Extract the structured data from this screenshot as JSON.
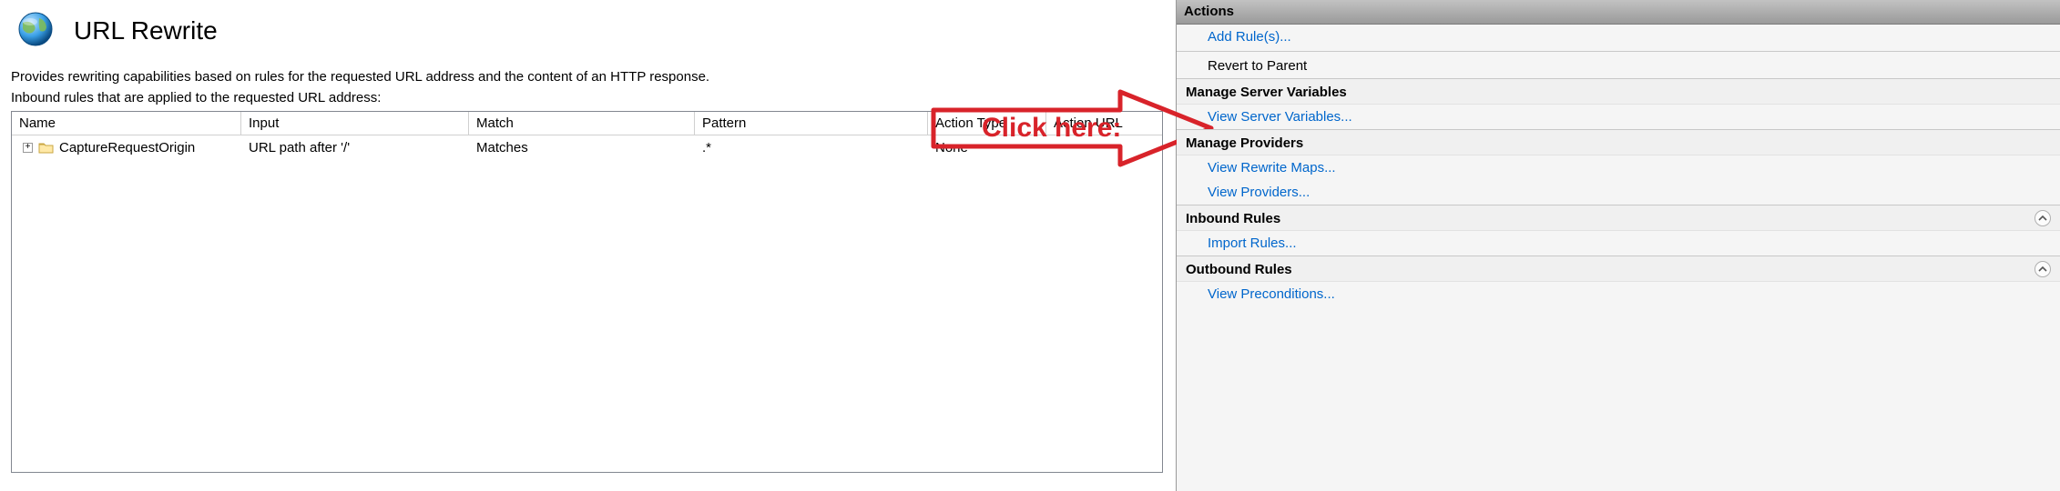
{
  "header": {
    "title": "URL Rewrite",
    "description": "Provides rewriting capabilities based on rules for the requested URL address and the content of an HTTP response.",
    "subdesc": "Inbound rules that are applied to the requested URL address:"
  },
  "grid": {
    "columns": {
      "name": "Name",
      "input": "Input",
      "match": "Match",
      "pattern": "Pattern",
      "action_type": "Action Type",
      "action_url": "Action URL"
    },
    "row": {
      "name": "CaptureRequestOrigin",
      "input": "URL path after '/'",
      "match": "Matches",
      "pattern": ".*",
      "action_type": "None",
      "action_url": ""
    }
  },
  "sidebar": {
    "title": "Actions",
    "add_rules": "Add Rule(s)...",
    "revert": "Revert to Parent",
    "section_msv": "Manage Server Variables",
    "view_sv": "View Server Variables...",
    "section_mp": "Manage Providers",
    "view_rm": "View Rewrite Maps...",
    "view_pr": "View Providers...",
    "section_ir": "Inbound Rules",
    "import_rules": "Import Rules...",
    "section_or": "Outbound Rules",
    "view_pre": "View Preconditions..."
  },
  "annotation": {
    "text": "Click here:"
  }
}
